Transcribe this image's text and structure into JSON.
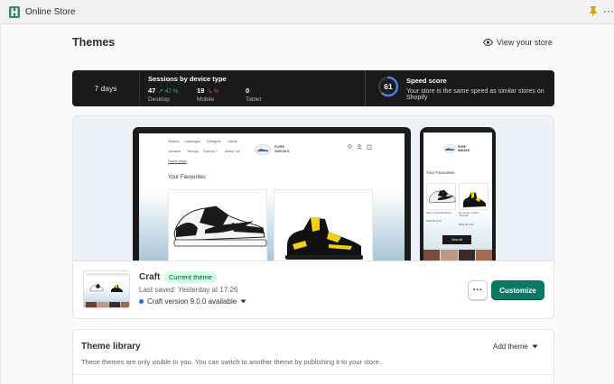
{
  "topbar": {
    "app_title": "Online Store",
    "more_label": "···"
  },
  "header": {
    "title": "Themes",
    "view_store_label": "View your store"
  },
  "stats": {
    "range_label": "7 days",
    "sessions_title": "Sessions by device type",
    "devices": [
      {
        "count": "47",
        "change": "↗ 47 %",
        "direction": "up",
        "label": "Desktop"
      },
      {
        "count": "19",
        "change": "↘ %",
        "direction": "down",
        "label": "Mobile"
      },
      {
        "count": "0",
        "change": "",
        "direction": "none",
        "label": "Tablet"
      }
    ],
    "speed_score": {
      "value": 61,
      "value_text": "61",
      "title": "Speed score",
      "description": "Your store is the same speed as similar stores on Shopify"
    }
  },
  "preview": {
    "desktop": {
      "nav_row1": [
        "Search",
        "Catalogue",
        "Designer",
        "Cards"
      ],
      "nav_row2": [
        "Jordans",
        "Yeezys",
        "Source +",
        "About Us"
      ],
      "breadcrumb": "Home page",
      "brand": "PURE SNEAKS",
      "section_title": "Your Favourites"
    },
    "mobile": {
      "brand": "PURE SNEAKS",
      "section_title": "Your Favourites",
      "item1_name": "Nike Low Panda Dunk",
      "item1_price": "$195.00 AUD",
      "item2_name": "Air Jordan 4 Retro 'Thunder'",
      "item2_price": "$340.00 AUD",
      "button": "View all"
    }
  },
  "current_theme": {
    "name": "Craft",
    "badge": "Current theme",
    "last_saved": "Last saved: Yesterday at 17:26",
    "version": "Craft version 9.0.0 available",
    "more_label": "···",
    "customize_label": "Customize"
  },
  "library": {
    "title": "Theme library",
    "description": "These themes are only visible to you. You can switch to another theme by publishing it to your store.",
    "add_theme_label": "Add theme"
  },
  "colors": {
    "accent": "#0b7a64",
    "badge_bg": "#cdfee1",
    "stats_bg": "#1a1a1a",
    "gauge": "#4f7fe6"
  }
}
